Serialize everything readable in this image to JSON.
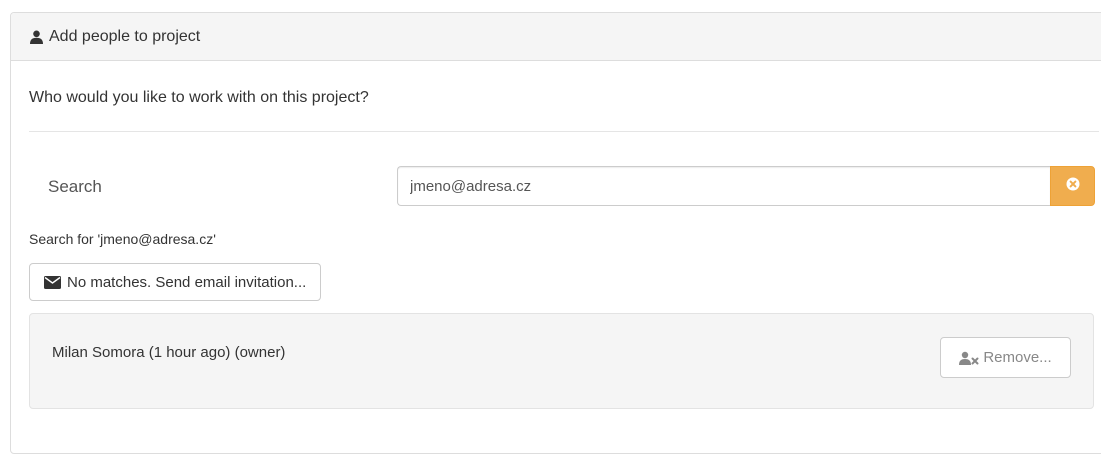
{
  "panel": {
    "title": "Add people to project",
    "title_icon": "user-icon"
  },
  "question": "Who would you like to work with on this project?",
  "search": {
    "label": "Search",
    "value": "jmeno@adresa.cz",
    "clear_icon": "times-circle-icon",
    "clear_color": "#f0ad4e",
    "search_for_text": "Search for 'jmeno@adresa.cz'"
  },
  "invite_button": {
    "label": "No matches. Send email invitation...",
    "icon": "envelope-icon"
  },
  "members": [
    {
      "name": "Milan Somora (1 hour ago) (owner)",
      "remove_label": "Remove...",
      "remove_icon": "user-times-icon"
    }
  ]
}
